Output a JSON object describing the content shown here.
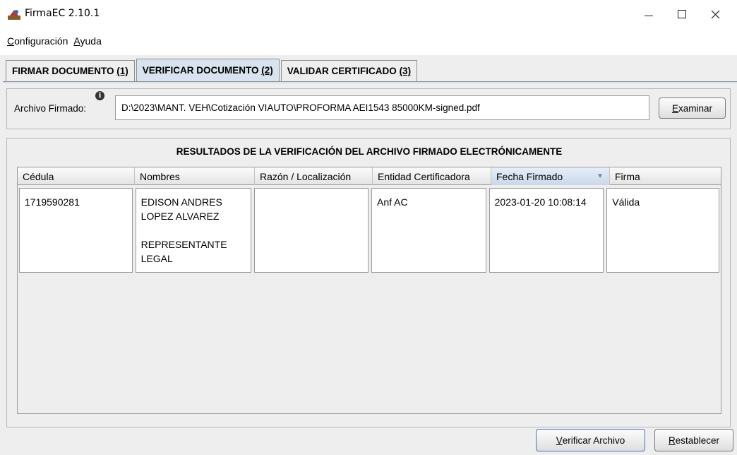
{
  "window": {
    "title": "FirmaEC 2.10.1",
    "icon": "firmaec-app-icon"
  },
  "menu": {
    "items": [
      {
        "label": "Configuración",
        "mnemonic": "C"
      },
      {
        "label": "Ayuda",
        "mnemonic": "A"
      }
    ]
  },
  "tabs": [
    {
      "label": "FIRMAR DOCUMENTO",
      "num": "(1)",
      "active": false
    },
    {
      "label": "VERIFICAR DOCUMENTO",
      "num": "(2)",
      "active": true
    },
    {
      "label": "VALIDAR CERTIFICADO",
      "num": "(3)",
      "active": false
    }
  ],
  "file": {
    "label": "Archivo Firmado:",
    "value": "D:\\2023\\MANT. VEH\\Cotización VIAUTO\\PROFORMA AEI1543 85000KM-signed.pdf",
    "browse_label": "Examinar"
  },
  "results": {
    "title": "RESULTADOS DE LA VERIFICACIÓN DEL ARCHIVO FIRMADO ELECTRÓNICAMENTE",
    "columns": [
      "Cédula",
      "Nombres",
      "Razón / Localización",
      "Entidad Certificadora",
      "Fecha Firmado",
      "Firma"
    ],
    "sorted_column": "Fecha Firmado",
    "rows": [
      {
        "cedula": "1719590281",
        "nombres_line1": "EDISON ANDRES",
        "nombres_line2": "LOPEZ ALVAREZ",
        "nombres_line3": "REPRESENTANTE",
        "nombres_line4": "LEGAL",
        "razon": "",
        "entidad": "Anf AC",
        "fecha": "2023-01-20 10:08:14",
        "firma": "Válida"
      }
    ]
  },
  "buttons": {
    "verificar": "Verificar Archivo",
    "restablecer": "Restablecer"
  }
}
